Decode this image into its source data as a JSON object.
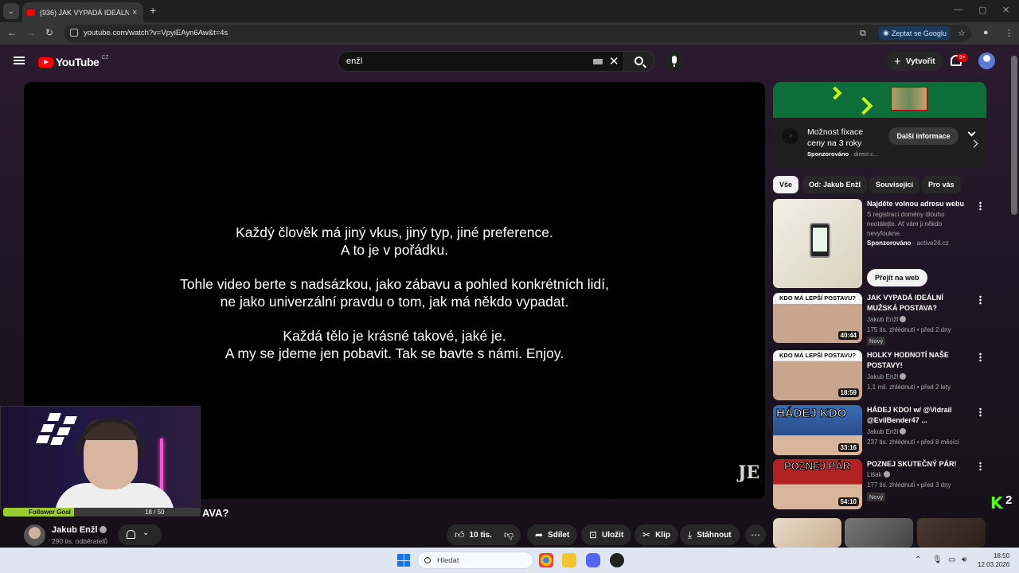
{
  "browser": {
    "tab_title": "(936) JAK VYPADÁ IDEÁLNÍ ŽEN",
    "url": "youtube.com/watch?v=VpyiEAyn6Aw&t=4s",
    "ask_google": "Zeptat se Googlu"
  },
  "header": {
    "logo_text": "YouTube",
    "logo_country": "CZ",
    "search_value": "enžl",
    "create_label": "Vytvořit",
    "notif_badge": "9+"
  },
  "video": {
    "subtitles": [
      "Každý člověk má jiný vkus, jiný typ, jiné preference.",
      "A to je v pořádku.",
      "Tohle video berte s nadsázkou, jako zábavu a pohled konkrétních lidí,",
      "ne jako univerzální pravdu o tom, jak má někdo vypadat.",
      "Každá tělo je krásné takové, jaké je.",
      "A my se jdeme jen pobavit. Tak se bavte s námi. Enjoy."
    ],
    "title_fragment": "AVA?",
    "follower_goal_label": "Follower Goal",
    "follower_goal_count": "18 / 50",
    "follower_goal_progress": 0.36
  },
  "channel": {
    "name": "Jakub Enžl",
    "subscribers": "290 tis. odběratelů"
  },
  "actions": {
    "likes": "10 tis.",
    "share": "Sdílet",
    "save": "Uložit",
    "clip": "Klip",
    "download": "Stáhnout"
  },
  "ad": {
    "title": "Možnost fixace ceny na 3 roky",
    "sponsored": "Sponzorováno",
    "domain": "direct.c...",
    "cta": "Další informace"
  },
  "chips": [
    "Vše",
    "Od: Jakub Enžl",
    "Související",
    "Pro vás"
  ],
  "ad2": {
    "title": "Najděte volnou adresu webu",
    "desc": "S registrací domény dlouho neotálejte. Ať vám ji někdo nevyfoukne.",
    "sponsored": "Sponzorováno",
    "domain": "active24.cz",
    "cta": "Přejít na web"
  },
  "recommendations": [
    {
      "title": "JAK VYPADÁ IDEÁLNÍ MUŽSKÁ POSTAVA?",
      "channel": "Jakub Enžl",
      "meta": "175 tis. zhlédnutí • před 2 dny",
      "badge": "Nový",
      "duration": "40:44",
      "thumb_text": "KDO MÁ LEPŠÍ POSTAVU?"
    },
    {
      "title": "HOLKY HODNOTÍ NAŠE POSTAVY!",
      "channel": "Jakub Enžl",
      "meta": "1,1 mil. zhlédnutí • před 2 lety",
      "badge": "",
      "duration": "18:59",
      "thumb_text": "KDO MÁ LEPŠÍ POSTAVU?"
    },
    {
      "title": "HÁDEJ KDO! w/ @Vidrail @EvilBender47 ...",
      "channel": "Jakub Enžl",
      "meta": "237 tis. zhlédnutí • před 8 měsíci",
      "badge": "",
      "duration": "33:16",
      "thumb_text": "HÁDEJ KDO"
    },
    {
      "title": "POZNEJ SKUTEČNÝ PÁR!",
      "channel": "Lišák",
      "meta": "177 tis. zhlédnutí • před 3 dny",
      "badge": "Nový",
      "duration": "54:10",
      "thumb_text": "POZNEJ PÁR"
    }
  ],
  "overlay": {
    "kick_letter": "K",
    "kick_number": "2"
  },
  "taskbar": {
    "search_label": "Hledat",
    "time": "18:50",
    "date": "12.03.2026"
  },
  "colors": {
    "youtube_red": "#ff0000",
    "kick_green": "#53fc18",
    "ad_green": "#0d6e3a"
  }
}
